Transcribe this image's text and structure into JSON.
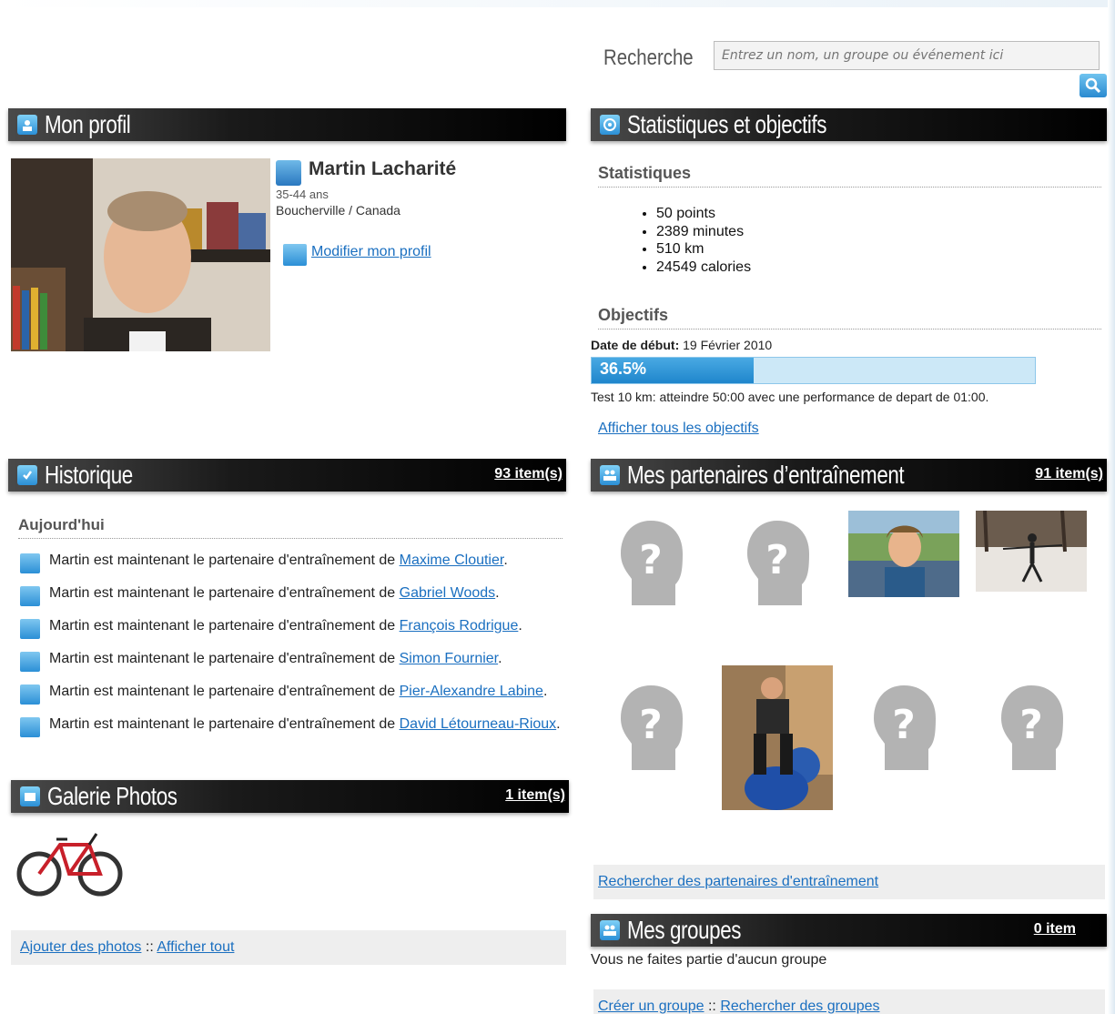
{
  "search": {
    "label": "Recherche",
    "placeholder": "Entrez un nom, un groupe ou événement ici"
  },
  "profile": {
    "header": "Mon profil",
    "name": "Martin Lacharité",
    "age": "35-44 ans",
    "location": "Boucherville / Canada",
    "edit_link": "Modifier mon profil"
  },
  "stats": {
    "header": "Statistiques et objectifs",
    "stats_title": "Statistiques",
    "items": [
      "50 points",
      "2389 minutes",
      "510 km",
      "24549 calories"
    ],
    "goals_title": "Objectifs",
    "start_label": "Date de début:",
    "start_date": "19 Février 2010",
    "progress_label": "36.5%",
    "progress_fraction": 0.365,
    "goal_text": "Test 10 km: atteindre 50:00 avec une performance de depart de 01:00.",
    "all_goals_link": "Afficher tous les objectifs"
  },
  "history": {
    "header": "Historique",
    "count": "93 item(s)",
    "today": "Aujourd'hui",
    "prefix": "Martin est maintenant le partenaire d'entraînement de",
    "items": [
      {
        "name": "Maxime Cloutier"
      },
      {
        "name": "Gabriel Woods"
      },
      {
        "name": "François Rodrigue"
      },
      {
        "name": "Simon Fournier"
      },
      {
        "name": "Pier-Alexandre Labine"
      },
      {
        "name": "David Létourneau-Rioux"
      }
    ]
  },
  "gallery": {
    "header": "Galerie Photos",
    "count": "1 item(s)",
    "add_link": "Ajouter des photos",
    "separator": "::",
    "all_link": "Afficher tout"
  },
  "partners": {
    "header": "Mes partenaires d’entraînement",
    "count": "91 item(s)",
    "search_link": "Rechercher des partenaires d'entraînement"
  },
  "groups": {
    "header": "Mes groupes",
    "count": "0 item",
    "empty_text": "Vous ne faites partie d'aucun groupe",
    "create_link": "Créer un groupe",
    "separator": "::",
    "search_link": "Rechercher des groupes"
  },
  "colors": {
    "link": "#1a6fc0",
    "accent": "#2b8fd6",
    "header_bg": "#000000"
  }
}
